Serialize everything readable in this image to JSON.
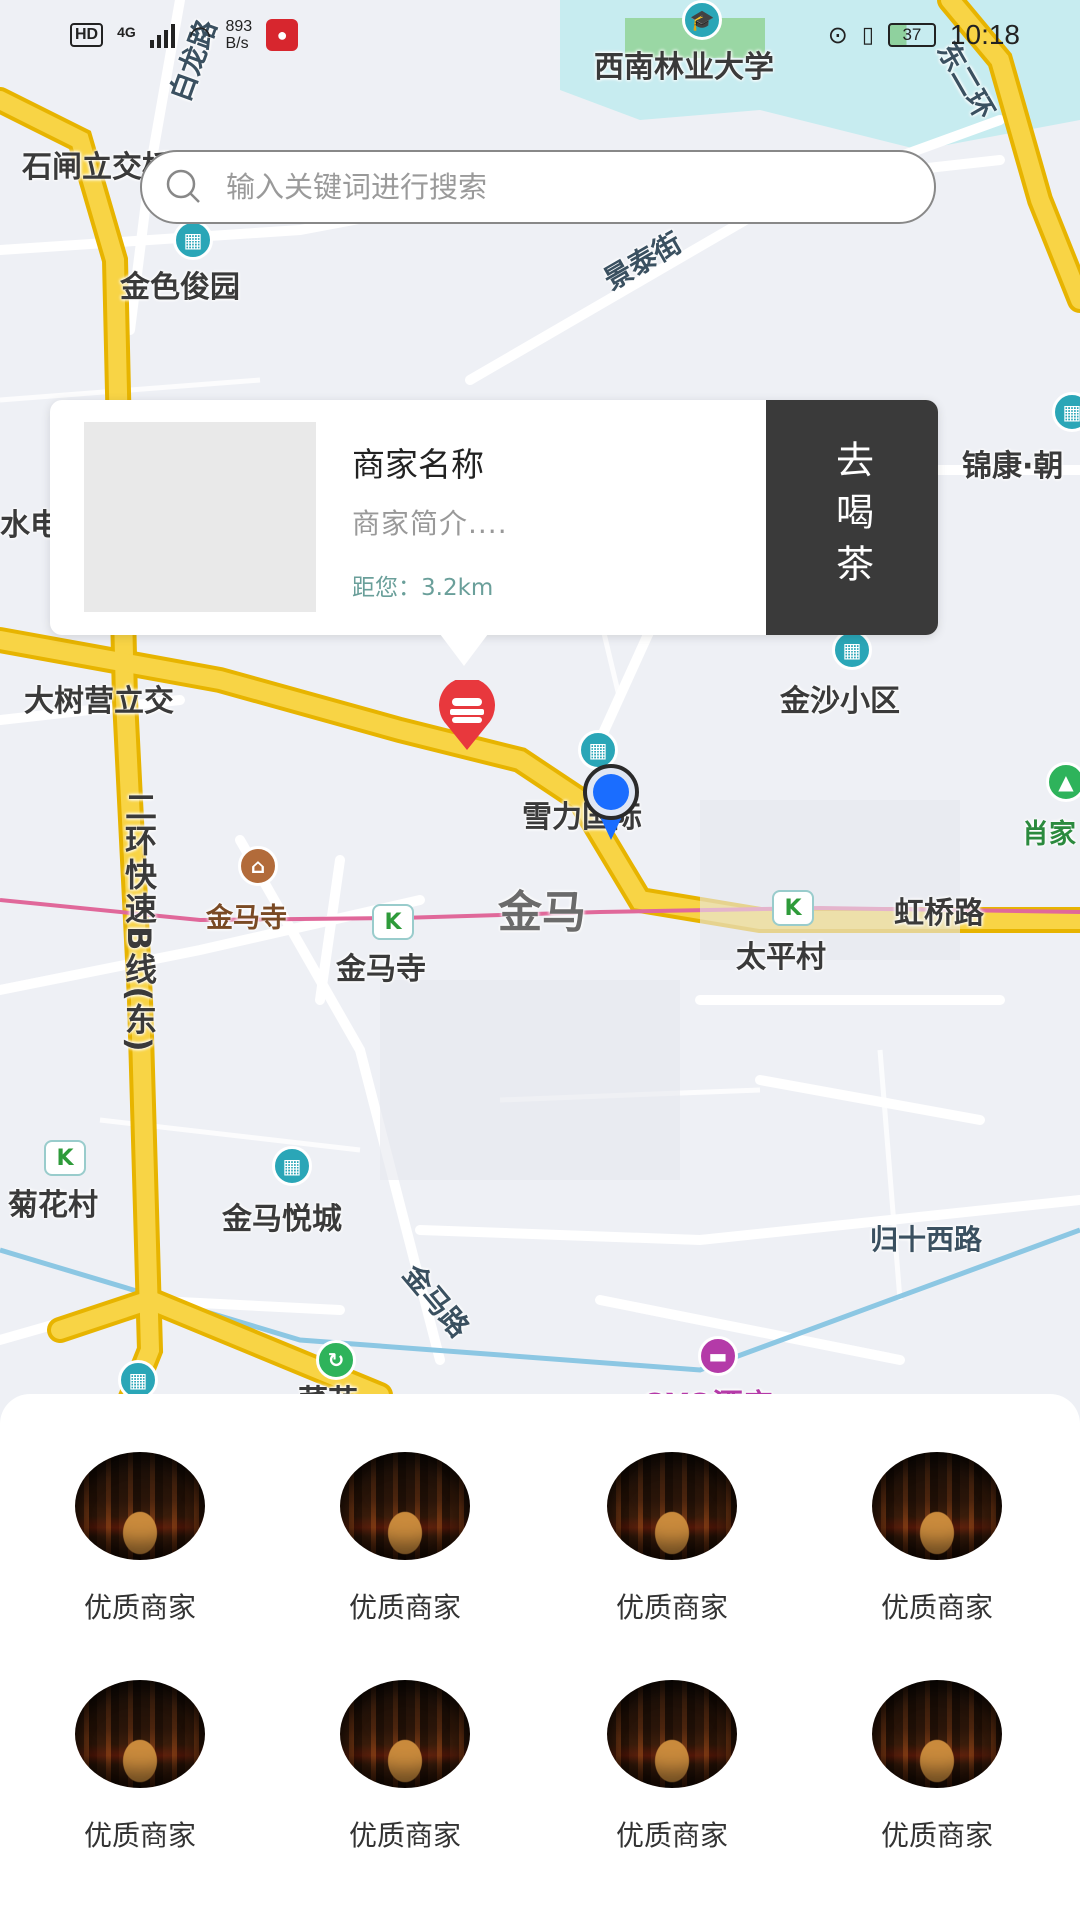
{
  "status_bar": {
    "hd": "HD",
    "network": "4G",
    "speed_value": "893",
    "speed_unit": "B/s",
    "battery": "37",
    "time": "10:18"
  },
  "search": {
    "placeholder": "输入关键词进行搜索"
  },
  "map": {
    "labels": {
      "university": "西南林业大学",
      "road_baolong": "白龙路",
      "east_ring": "东二环",
      "shizha": "石闸立交桥",
      "jinse": "金色俊园",
      "jingtai": "景泰街",
      "jinkang": "锦康·朝",
      "dianchang": "水电",
      "dashuying": "大树营立交",
      "jinsha": "金沙小区",
      "xueli": "雪力国际",
      "xiaojia": "肖家",
      "ring_b": "二环快速B线(东)",
      "jinmasi_poi": "金马寺",
      "jinma_area": "金马",
      "hongqiao": "虹桥路",
      "jinmasi_metro": "金马寺",
      "taiping": "太平村",
      "juhua": "菊花村",
      "jinma_yuecheng": "金马悦城",
      "guishi_west": "归十西路",
      "jinma_road": "金马路",
      "caihua": "菜花",
      "hotel": "OYO酒店"
    }
  },
  "info_card": {
    "name": "商家名称",
    "intro": "商家简介....",
    "distance": "距您：3.2km",
    "go_button": "去喝茶"
  },
  "merchants": [
    {
      "label": "优质商家"
    },
    {
      "label": "优质商家"
    },
    {
      "label": "优质商家"
    },
    {
      "label": "优质商家"
    },
    {
      "label": "优质商家"
    },
    {
      "label": "优质商家"
    },
    {
      "label": "优质商家"
    },
    {
      "label": "优质商家"
    }
  ],
  "colors": {
    "highway": "#f2c811",
    "metro_line": "#e0689a",
    "water": "#c7ecf0",
    "card_button": "#3a3a3a",
    "merchant_pin": "#e8383d",
    "location_dot": "#1a6dff"
  }
}
